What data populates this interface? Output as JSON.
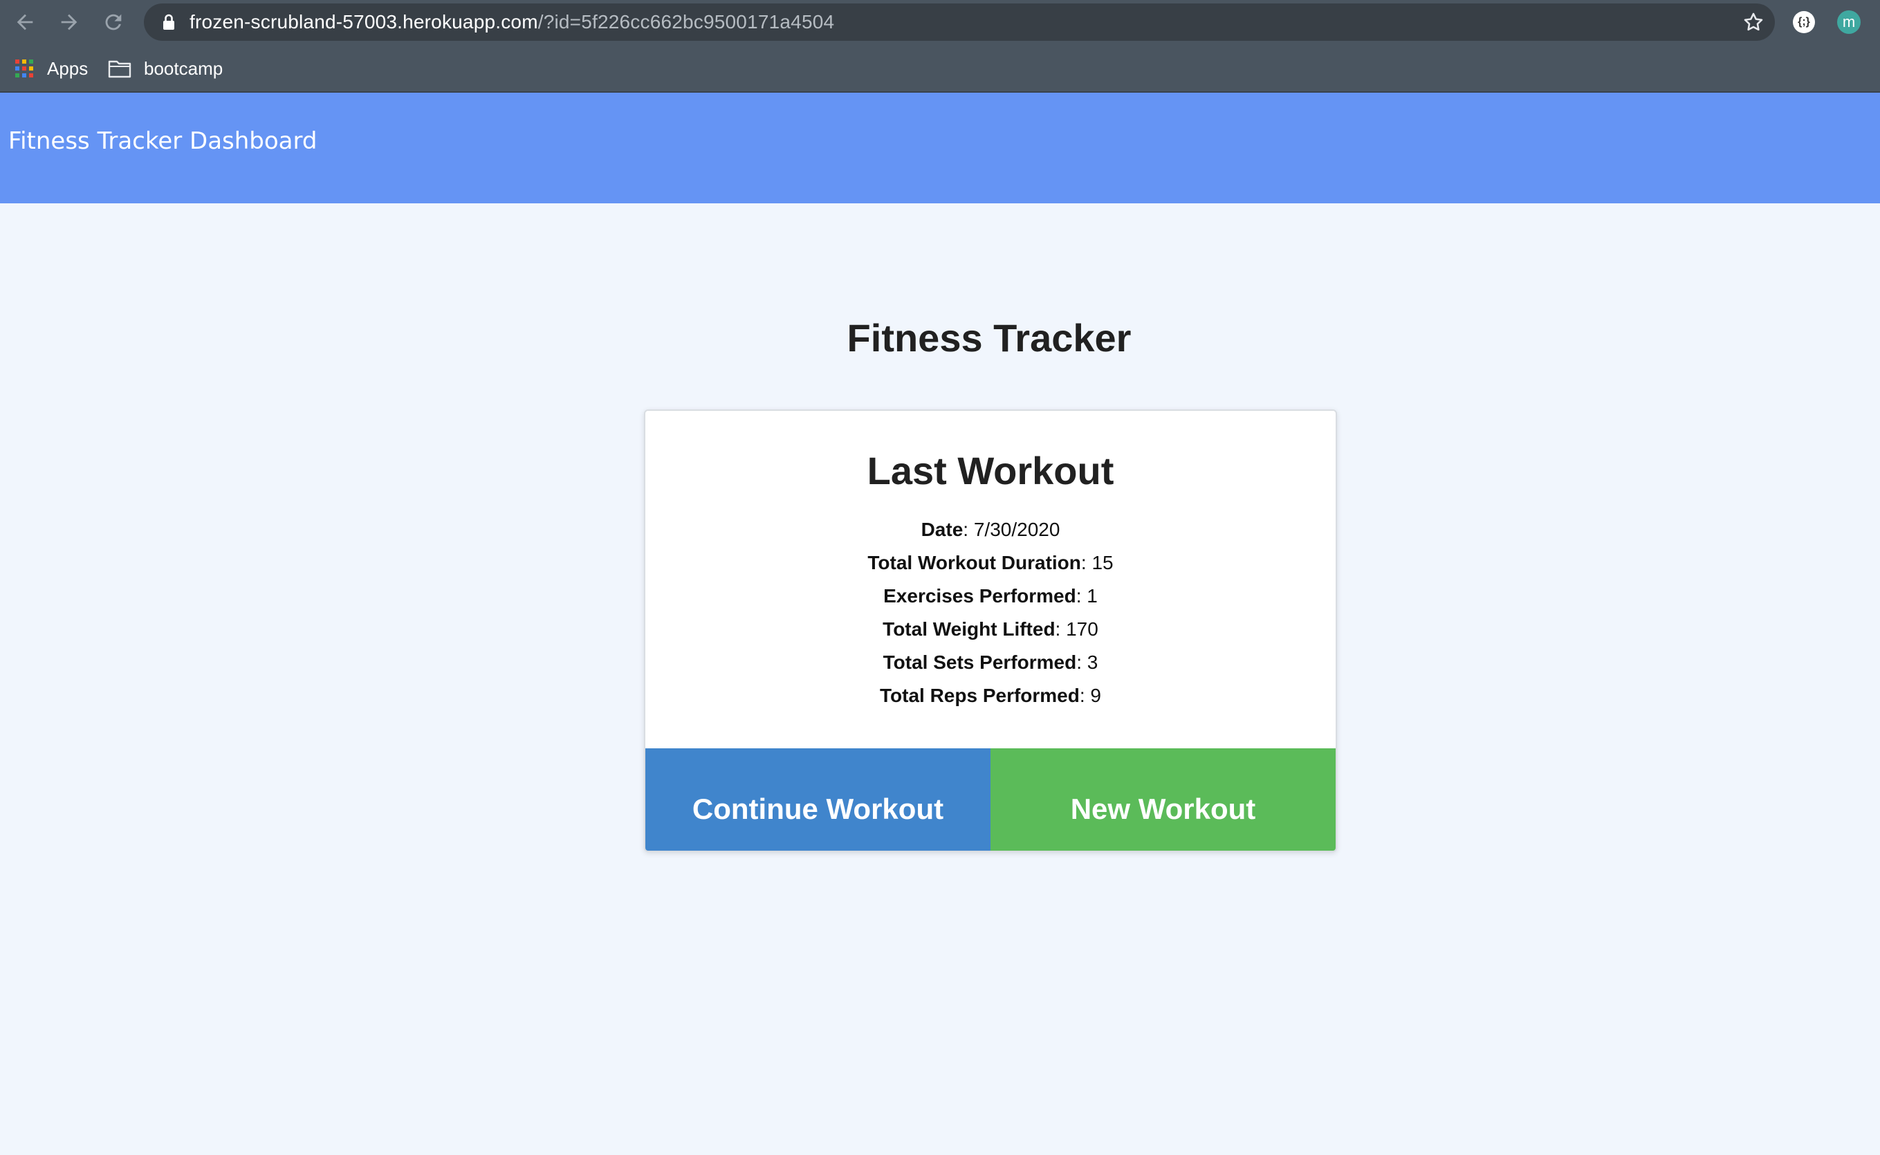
{
  "browser": {
    "url_host": "frozen-scrubland-57003.herokuapp.com",
    "url_path": "/?id=5f226cc662bc9500171a4504",
    "profile_initial": "m",
    "extension_icon": "extension-icon",
    "bookmarks": [
      {
        "label": "Apps",
        "icon": "apps-grid-icon"
      },
      {
        "label": "bootcamp",
        "icon": "folder-icon"
      }
    ]
  },
  "header": {
    "brand": "Fitness Tracker Dashboard",
    "color": "#6594f4"
  },
  "main": {
    "title": "Fitness Tracker",
    "card": {
      "title": "Last Workout",
      "stats": [
        {
          "label": "Date",
          "value": ": 7/30/2020"
        },
        {
          "label": "Total Workout Duration",
          "value": ": 15"
        },
        {
          "label": "Exercises Performed",
          "value": ": 1"
        },
        {
          "label": "Total Weight Lifted",
          "value": ": 170"
        },
        {
          "label": "Total Sets Performed",
          "value": ": 3"
        },
        {
          "label": "Total Reps Performed",
          "value": ": 9"
        }
      ],
      "buttons": {
        "continue": "Continue Workout",
        "new": "New Workout"
      }
    }
  },
  "colors": {
    "continue_button": "#4085cc",
    "new_button": "#5bbb59",
    "page_background": "#f1f6fd"
  }
}
